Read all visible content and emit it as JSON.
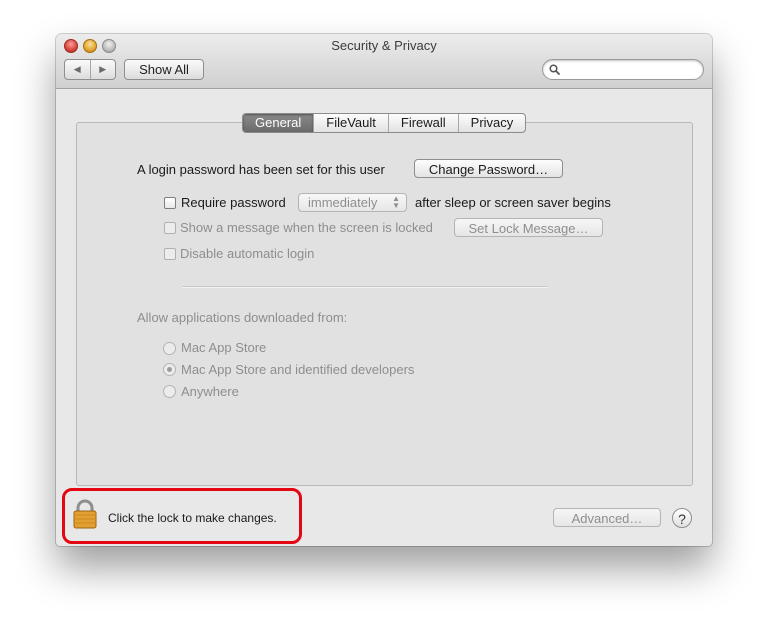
{
  "window": {
    "title": "Security & Privacy"
  },
  "toolbar": {
    "back_icon": "back-arrow-icon",
    "forward_icon": "forward-arrow-icon",
    "back_glyph": "◀",
    "forward_glyph": "▶",
    "show_all_label": "Show All",
    "search_value": "",
    "search_placeholder": ""
  },
  "tabs": [
    {
      "label": "General",
      "active": true
    },
    {
      "label": "FileVault",
      "active": false
    },
    {
      "label": "Firewall",
      "active": false
    },
    {
      "label": "Privacy",
      "active": false
    }
  ],
  "general": {
    "login_password_text": "A login password has been set for this user",
    "change_password_label": "Change Password…",
    "require_password_label": "Require password",
    "require_password_checked": false,
    "require_password_delay": "immediately",
    "after_sleep_text": "after sleep or screen saver begins",
    "show_message_label": "Show a message when the screen is locked",
    "show_message_checked": false,
    "set_lock_message_label": "Set Lock Message…",
    "disable_auto_login_label": "Disable automatic login",
    "disable_auto_login_checked": false,
    "allow_apps_label": "Allow applications downloaded from:",
    "allow_apps_options": [
      {
        "label": "Mac App Store",
        "selected": false
      },
      {
        "label": "Mac App Store and identified developers",
        "selected": true
      },
      {
        "label": "Anywhere",
        "selected": false
      }
    ]
  },
  "footer": {
    "lock_icon": "lock-icon",
    "lock_text": "Click the lock to make changes.",
    "advanced_label": "Advanced…",
    "help_label": "?"
  },
  "colors": {
    "annotation_highlight": "#e30613",
    "active_tab": "#7a7a7a",
    "lock_body": "#e3a032"
  }
}
